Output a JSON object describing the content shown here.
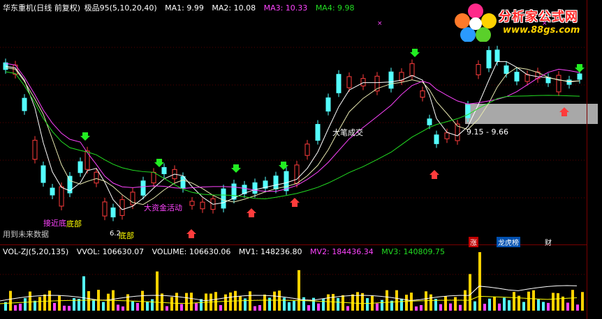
{
  "price_header": {
    "title": "华东重机(日线 前复权)",
    "indicator": "极品95(5,10,20,40)",
    "ma1": "MA1: 9.99",
    "ma2": "MA2: 10.08",
    "ma3": "MA3: 10.33",
    "ma4": "MA4: 9.98"
  },
  "volume_header": {
    "indicator": "VOL-ZJ(5,20,135)",
    "vvol": "VVOL: 106630.07",
    "volume": "VOLUME: 106630.06",
    "mv1": "MV1: 148236.80",
    "mv2": "MV2: 184436.34",
    "mv3": "MV3: 140809.75"
  },
  "annotations": {
    "big_trade": "大笔成交",
    "big_money": "大资金活动",
    "bottom_1": "底部",
    "bottom_2": "底部",
    "accept": "接近底",
    "range_label": "9.15 - 9.66",
    "future_data": "用到未来数据",
    "zhang": "涨",
    "longhu": "龙虎榜",
    "cai": "财",
    "low_val": "6.2"
  },
  "logo": {
    "title": "分析家公式网",
    "url": "www.88gs.com"
  },
  "colors": {
    "up": "#ff3c3c",
    "down": "#54ffff",
    "ma1": "#ffffff",
    "ma2": "#ffff00",
    "ma3": "#ff44ff",
    "ma4": "#22dd22",
    "arrow_down": "#22ee22",
    "arrow_up": "#ff3c3c",
    "highlight_box": "#a8a8a8"
  }
}
